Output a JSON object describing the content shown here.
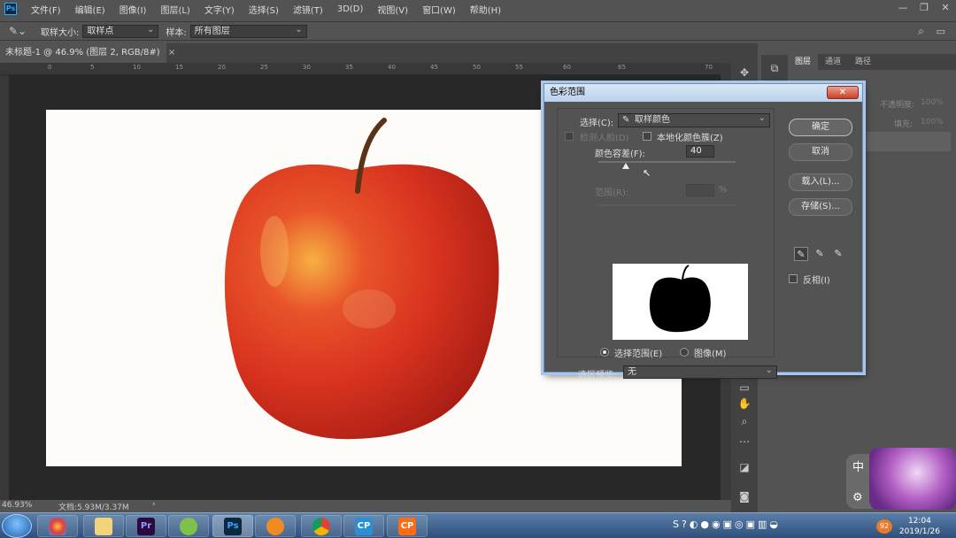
{
  "app": {
    "logo": "Ps",
    "menu": [
      "文件(F)",
      "编辑(E)",
      "图像(I)",
      "图层(L)",
      "文字(Y)",
      "选择(S)",
      "滤镜(T)",
      "3D(D)",
      "视图(V)",
      "窗口(W)",
      "帮助(H)"
    ]
  },
  "window_controls": {
    "minimize": "—",
    "restore": "❐",
    "close": "✕"
  },
  "options_bar": {
    "tool_icon": "eyedropper-icon",
    "sample_size_label": "取样大小:",
    "sample_size_value": "取样点",
    "sample_label": "样本:",
    "sample_value": "所有图层"
  },
  "document": {
    "tab_title": "未标题-1 @ 46.9% (图层 2, RGB/8#)",
    "tab_close": "×",
    "ruler_ticks": [
      "0",
      "5",
      "10",
      "15",
      "20",
      "25",
      "30",
      "35",
      "40",
      "45",
      "50",
      "55",
      "60",
      "65",
      "70"
    ],
    "zoom": "46.93%",
    "doc_info": "文档:5.93M/3.37M",
    "status_arrow": "›"
  },
  "panels": {
    "tabs": [
      "图层",
      "通道",
      "路径"
    ],
    "opacity_label": "不透明度:",
    "opacity_value": "100%",
    "fill_label": "填充:",
    "fill_value": "100%"
  },
  "dialog": {
    "title": "色彩范围",
    "close": "✕",
    "select_label": "选择(C):",
    "select_value": "取样颜色",
    "detect_faces_label": "检测人脸(D)",
    "localized_label": "本地化颜色簇(Z)",
    "fuzziness_label": "颜色容差(F):",
    "fuzziness_value": "40",
    "fuzziness_level": 0.2,
    "range_label": "范围(R):",
    "range_unit": "%",
    "radio_selection": "选择范围(E)",
    "radio_image": "图像(M)",
    "preview_label": "选区预览:",
    "preview_value": "无",
    "ok": "确定",
    "cancel": "取消",
    "load": "载入(L)...",
    "save": "存储(S)...",
    "invert_label": "反相(I)"
  },
  "taskbar": {
    "apps": [
      "Pr",
      "Ps",
      "CP",
      "CP"
    ],
    "clock_time": "12:04",
    "clock_date": "2019/1/26",
    "badge": "92"
  },
  "ime": {
    "label": "中"
  },
  "colors": {
    "ps_blue": "#31a8ff",
    "pr_purple": "#9999ff",
    "cp_orange": "#ff6a13",
    "close_red": "#c7422a"
  }
}
